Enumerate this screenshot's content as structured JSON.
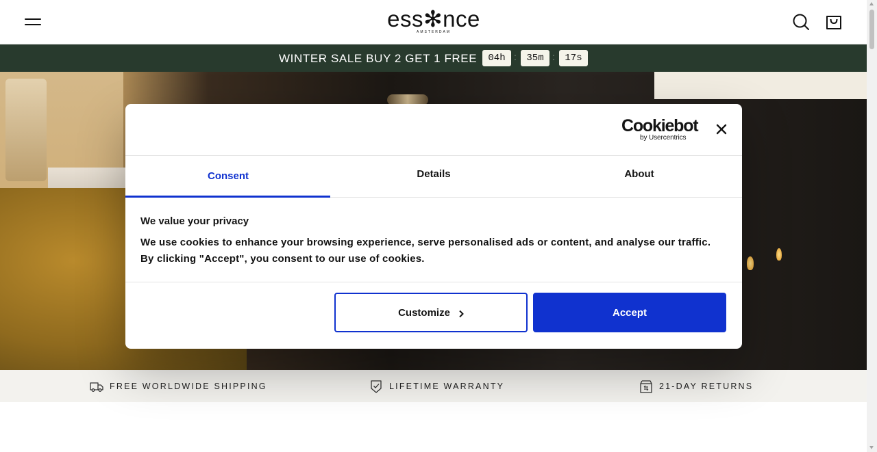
{
  "header": {
    "logo": "ess✻nce",
    "logo_sub": "AMSTERDAM",
    "menu_icon": "hamburger-menu-icon",
    "search_icon": "search-icon",
    "cart_icon": "shopping-bag-icon"
  },
  "promo": {
    "text": "WINTER SALE BUY 2 GET 1 FREE",
    "timer": {
      "hours": "04h",
      "minutes": "35m",
      "seconds": "17s",
      "separator": ":"
    },
    "background": "#283a2d"
  },
  "trust_bar": {
    "items": [
      {
        "icon": "truck-icon",
        "label": "FREE WORLDWIDE SHIPPING"
      },
      {
        "icon": "shield-check-icon",
        "label": "LIFETIME WARRANTY"
      },
      {
        "icon": "returns-box-icon",
        "label": "21-DAY RETURNS"
      }
    ]
  },
  "cookie_dialog": {
    "logo_main": "Cookiebot",
    "logo_sub": "by Usercentrics",
    "close_icon": "close-icon",
    "tabs": [
      {
        "label": "Consent",
        "active": true
      },
      {
        "label": "Details",
        "active": false
      },
      {
        "label": "About",
        "active": false
      }
    ],
    "title": "We value your privacy",
    "text": "We use cookies to enhance your browsing experience, serve personalised ads or content, and analyse our traffic. By clicking \"Accept\", you consent to our use of cookies.",
    "buttons": {
      "customize": "Customize",
      "accept": "Accept"
    },
    "accent_color": "#1032cf"
  }
}
